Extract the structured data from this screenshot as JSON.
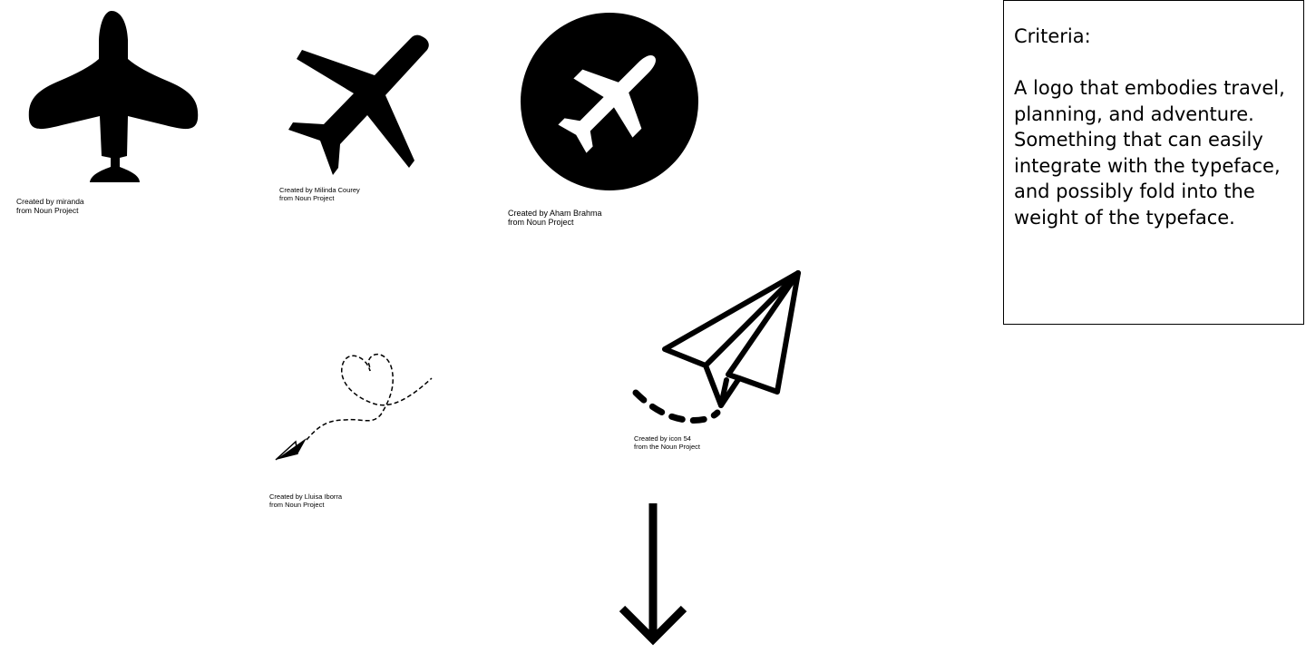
{
  "icons": [
    {
      "name": "airplane-silhouette-icon",
      "credit_line1": "Created by miranda",
      "credit_line2": "from Noun Project"
    },
    {
      "name": "airplane-diagonal-icon",
      "credit_line1": "Created by Milinda Courey",
      "credit_line2": "from Noun Project"
    },
    {
      "name": "airplane-circle-icon",
      "credit_line1": "Created by Aham Brahma",
      "credit_line2": "from Noun Project"
    },
    {
      "name": "paper-plane-heart-trail-icon",
      "credit_line1": "Created by Lluisa Iborra",
      "credit_line2": "from Noun Project"
    },
    {
      "name": "paper-plane-outline-icon",
      "credit_line1": "Created by icon 54",
      "credit_line2": "from the Noun Project"
    },
    {
      "name": "arrow-down-icon"
    }
  ],
  "criteria": {
    "heading": "Criteria:",
    "body": "A logo that embodies travel, planning, and adventure. Something that can easily integrate with the typeface, and possibly fold into the weight of the typeface."
  },
  "colors": {
    "ink": "#000000",
    "background": "#ffffff"
  }
}
